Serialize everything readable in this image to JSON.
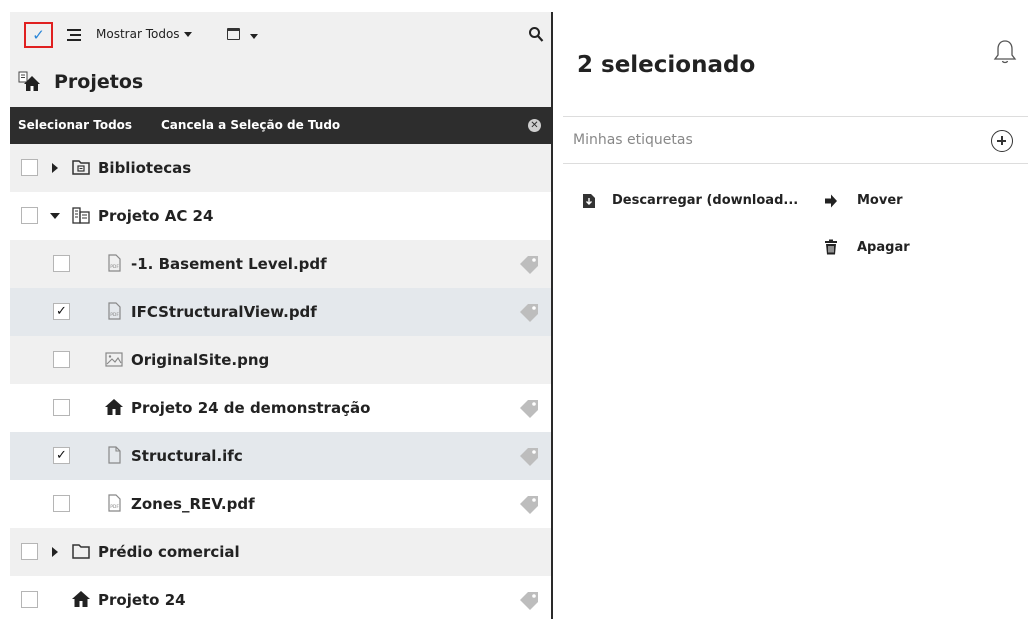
{
  "toolbar": {
    "filter_label": "Mostrar Todos"
  },
  "navigator": {
    "title": "Projetos"
  },
  "selection_bar": {
    "select_all": "Selecionar Todos",
    "deselect_all": "Cancela a Seleção de Tudo"
  },
  "tree": {
    "items": [
      {
        "label": "Bibliotecas",
        "checked": false
      },
      {
        "label": "Projeto AC 24",
        "checked": false
      },
      {
        "label": "-1. Basement Level.pdf",
        "checked": false
      },
      {
        "label": "IFCStructuralView.pdf",
        "checked": true
      },
      {
        "label": "OriginalSite.png",
        "checked": false
      },
      {
        "label": "Projeto 24 de demonstração",
        "checked": false
      },
      {
        "label": "Structural.ifc",
        "checked": true
      },
      {
        "label": "Zones_REV.pdf",
        "checked": false
      },
      {
        "label": "Prédio comercial",
        "checked": false
      },
      {
        "label": "Projeto 24",
        "checked": false
      }
    ]
  },
  "details": {
    "title": "2 selecionado",
    "tags_label": "Minhas etiquetas",
    "actions": {
      "download": "Descarregar (download...",
      "move": "Mover",
      "delete": "Apagar"
    }
  },
  "colors": {
    "accent_check": "#2a86d8",
    "highlight_border": "#e02020",
    "dark_bar": "#2d2d2d"
  }
}
